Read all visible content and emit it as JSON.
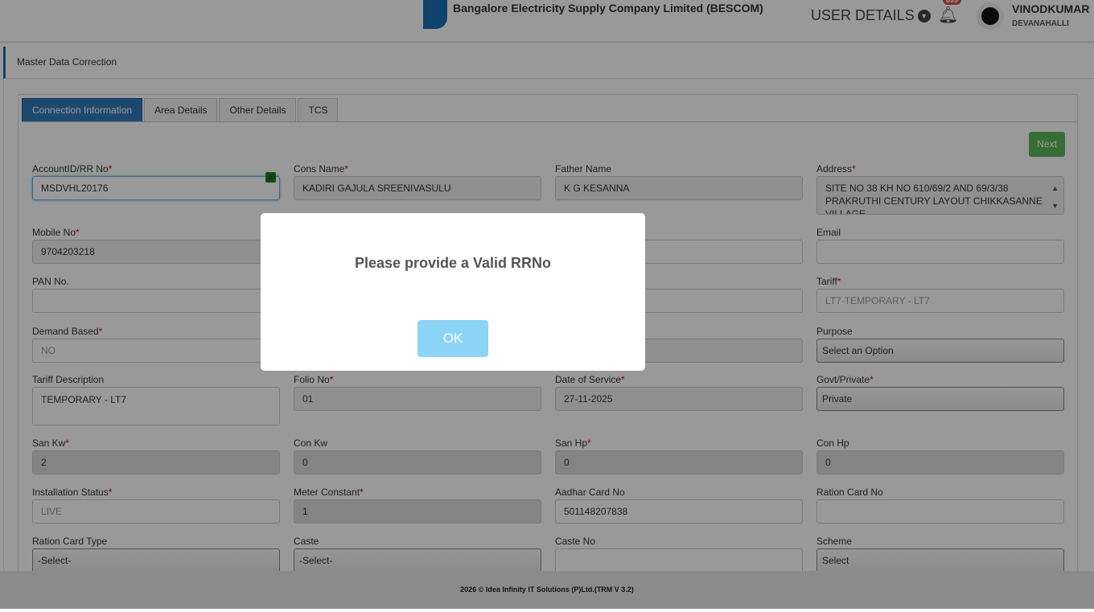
{
  "header": {
    "logo_text": "BESCOM",
    "company": "Bangalore Electricity Supply Company Limited (BESCOM)",
    "user_details": "USER DETAILS",
    "notification_count": "899",
    "user_name": "VINODKUMAR",
    "user_location": "DEVANAHALLI"
  },
  "page_title": "Master Data Correction",
  "tabs": [
    "Connection Information",
    "Area Details",
    "Other Details",
    "TCS"
  ],
  "next_label": "Next",
  "fields": {
    "account": {
      "label": "AccountID/RR No",
      "value": "MSDVHL20176"
    },
    "cons_name": {
      "label": "Cons Name",
      "value": "KADIRI GAJULA  SREENIVASULU"
    },
    "father": {
      "label": "Father Name",
      "value": "K G KESANNA"
    },
    "address": {
      "label": "Address",
      "value": "SITE NO 38 KH NO 610/69/2 AND 69/3/38 PRAKRUTHI CENTURY LAYOUT CHIKKASANNE VILLAGE"
    },
    "mobile": {
      "label": "Mobile No",
      "value": "9704203218"
    },
    "email": {
      "label": "Email",
      "value": ""
    },
    "pan": {
      "label": "PAN No.",
      "value": ""
    },
    "tariff": {
      "label": "Tariff",
      "value": "LT7-TEMPORARY - LT7"
    },
    "demand": {
      "label": "Demand Based",
      "value": "NO"
    },
    "purpose": {
      "label": "Purpose",
      "value": "Select an Option"
    },
    "tariff_desc": {
      "label": "Tariff Description",
      "value": "TEMPORARY - LT7"
    },
    "folio": {
      "label": "Folio No",
      "value": "01"
    },
    "date_service": {
      "label": "Date of Service",
      "value": "27-11-2025"
    },
    "govt": {
      "label": "Govt/Private",
      "value": "Private"
    },
    "san_kw": {
      "label": "San Kw",
      "value": "2"
    },
    "con_kw": {
      "label": "Con Kw",
      "value": "0"
    },
    "san_hp": {
      "label": "San Hp",
      "value": "0"
    },
    "con_hp": {
      "label": "Con Hp",
      "value": "0"
    },
    "install": {
      "label": "Installation Status",
      "value": "LIVE"
    },
    "meter_const": {
      "label": "Meter Constant",
      "value": "1"
    },
    "aadhar": {
      "label": "Aadhar Card No",
      "value": "501148207838"
    },
    "ration": {
      "label": "Ration Card No",
      "value": ""
    },
    "ration_type": {
      "label": "Ration Card Type",
      "value": "-Select-"
    },
    "caste": {
      "label": "Caste",
      "value": "-Select-"
    },
    "caste_no": {
      "label": "Caste No",
      "value": ""
    },
    "scheme": {
      "label": "Scheme",
      "value": "Select"
    }
  },
  "footer": "2026 © Idea Infinity IT Solutions (P)Ltd.(TRM V 3.2)",
  "modal": {
    "message": "Please provide a Valid RRNo",
    "ok_label": "OK"
  }
}
